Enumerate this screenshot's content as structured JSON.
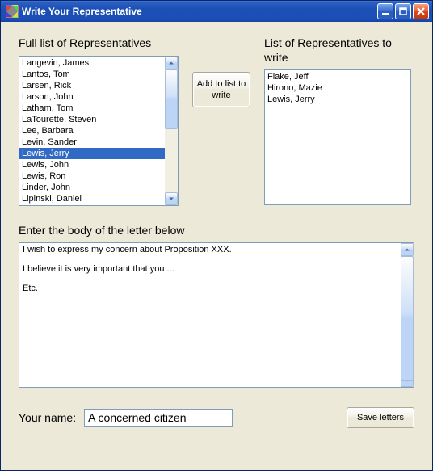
{
  "window": {
    "title": "Write Your Representative"
  },
  "labels": {
    "full_list": "Full list of Representatives",
    "write_list": "List of Representatives to write",
    "body_prompt": "Enter the body of the letter below",
    "your_name": "Your name:"
  },
  "full_list": {
    "items": [
      "Langevin, James",
      "Lantos, Tom",
      "Larsen, Rick",
      "Larson, John",
      "Latham, Tom",
      "LaTourette, Steven",
      "Lee, Barbara",
      "Levin, Sander",
      "Lewis, Jerry",
      "Lewis, John",
      "Lewis, Ron",
      "Linder, John",
      "Lipinski, Daniel"
    ],
    "selected_index": 8
  },
  "write_list": {
    "items": [
      "Flake, Jeff",
      "Hirono, Mazie",
      "Lewis, Jerry"
    ]
  },
  "buttons": {
    "add": "Add to list to write",
    "save": "Save letters"
  },
  "letter_body": "I wish to express my concern about Proposition XXX.\n\nI believe it is very important that you ...\n\nEtc.",
  "your_name_value": "A concerned citizen"
}
